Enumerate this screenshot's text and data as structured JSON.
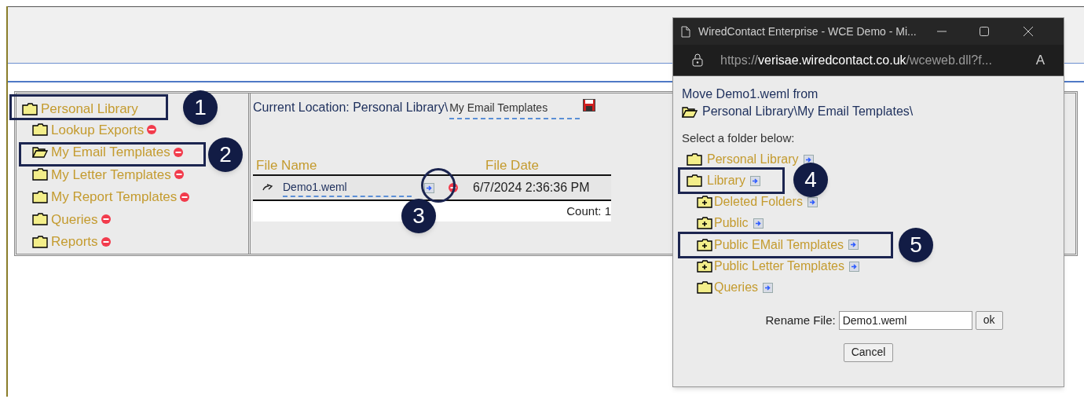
{
  "library_tree": {
    "label": "Personal Library",
    "open": false,
    "children": [
      {
        "label": "Lookup Exports",
        "open": false
      },
      {
        "label": "My Email Templates",
        "open": true
      },
      {
        "label": "My Letter Templates",
        "open": false
      },
      {
        "label": "My Report Templates",
        "open": false
      },
      {
        "label": "Queries",
        "open": false
      },
      {
        "label": "Reports",
        "open": false
      }
    ]
  },
  "location": {
    "label": "Current Location: Personal Library\\",
    "value": "My Email Templates"
  },
  "file_table": {
    "columns": [
      "File Name",
      "File Date"
    ],
    "rows": [
      {
        "file_name": "Demo1.weml",
        "file_date": "6/7/2024 2:36:36 PM"
      }
    ],
    "count": "Count: 1"
  },
  "move_popup": {
    "window_title": "WiredContact Enterprise - WCE Demo - Mi...",
    "url": {
      "scheme": "https://",
      "host": "verisae.wiredcontact.co.uk",
      "path": "/wceweb.dll?f..."
    },
    "read_aloud_glyph": "A",
    "heading": "Move Demo1.weml from",
    "source_path": "Personal Library\\My Email Templates\\",
    "prompt": "Select a folder below:",
    "folders": [
      {
        "label": "Personal Library",
        "kind": "folder"
      },
      {
        "label": "Library",
        "kind": "folder",
        "children": [
          {
            "label": "Deleted Folders",
            "kind": "folder-plus"
          },
          {
            "label": "Public",
            "kind": "folder-plus"
          },
          {
            "label": "Public EMail Templates",
            "kind": "folder-plus"
          },
          {
            "label": "Public Letter Templates",
            "kind": "folder-plus"
          },
          {
            "label": "Queries",
            "kind": "folder"
          }
        ]
      }
    ],
    "rename_label": "Rename File:",
    "rename_value": "Demo1.weml",
    "ok": "ok",
    "cancel": "Cancel"
  },
  "callouts": [
    {
      "number": "1",
      "kind": "box"
    },
    {
      "number": "2",
      "kind": "box"
    },
    {
      "number": "3",
      "kind": "ring"
    },
    {
      "number": "4",
      "kind": "box"
    },
    {
      "number": "5",
      "kind": "box"
    }
  ]
}
